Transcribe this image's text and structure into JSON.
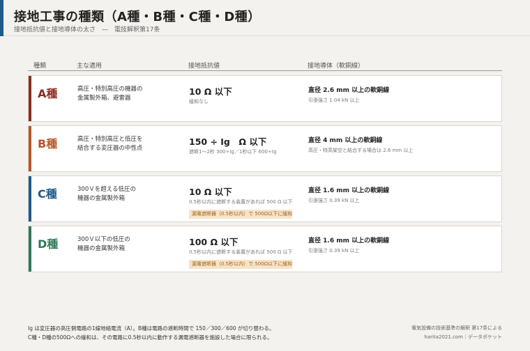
{
  "header": {
    "title": "接地工事の種類（A種・B種・C種・D種）",
    "subtitle": "接地抵抗値と接地導体の太さ　—　電技解釈第17条"
  },
  "columns": {
    "type": "種類",
    "application": "主な適用",
    "resistance": "接地抵抗値",
    "conductor": "接地導体（軟銅線）"
  },
  "colors": {
    "A": "#8b2c24",
    "B": "#b5572a",
    "C": "#1e5a8a",
    "D": "#2f7a5a",
    "accent": "#1e5a8a",
    "relief_bg": "#f6e3c8"
  },
  "rows": [
    {
      "cls": "A種",
      "app1": "高圧・特別高圧の機器の",
      "app2": "金属製外箱、避雷器",
      "res": "10 Ω 以下",
      "resnote": "緩和なし",
      "relief": "",
      "cond": "直径 2.6 mm 以上の軟銅線",
      "condnote": "引張強さ 1.04 kN 以上"
    },
    {
      "cls": "B種",
      "app1": "高圧・特別高圧と低圧を",
      "app2": "結合する変圧器の中性点",
      "res": "150 ÷ Ig　Ω 以下",
      "resnote": "遮断1〜2秒 300÷Ig／1秒以下 600÷Ig",
      "relief": "",
      "cond": "直径 4 mm 以上の軟銅線",
      "condnote": "高圧・特高架空と結合する場合は 2.6 mm 以上"
    },
    {
      "cls": "C種",
      "app1": "300Ｖを超える低圧の",
      "app2": "機器の金属製外箱",
      "res": "10 Ω 以下",
      "resnote": "0.5秒以内に遮断する装置があれば 500 Ω 以下",
      "relief": "漏電遮断器（0.5秒以内）で 500Ω以下に緩和",
      "cond": "直径 1.6 mm 以上の軟銅線",
      "condnote": "引張強さ 0.39 kN 以上"
    },
    {
      "cls": "D種",
      "app1": "300Ｖ以下の低圧の",
      "app2": "機器の金属製外箱",
      "res": "100 Ω 以下",
      "resnote": "0.5秒以内に遮断する装置があれば 500 Ω 以下",
      "relief": "漏電遮断器（0.5秒以内）で 500Ω以下に緩和",
      "cond": "直径 1.6 mm 以上の軟銅線",
      "condnote": "引張強さ 0.39 kN 以上"
    }
  ],
  "footnote": {
    "line1": "Ig は変圧器の高圧側電路の1線地絡電流（A）。B種は電路の遮断時間で 150／300／600 が切り替わる。",
    "line2": "C種・D種の500Ωへの緩和は、その電路に0.5秒以内に動作する漏電遮断器を施設した場合に限られる。"
  },
  "source": {
    "line1": "電気設備の技術基準の解釈 第17条による",
    "line2": "harita2021.com｜データポケット"
  }
}
